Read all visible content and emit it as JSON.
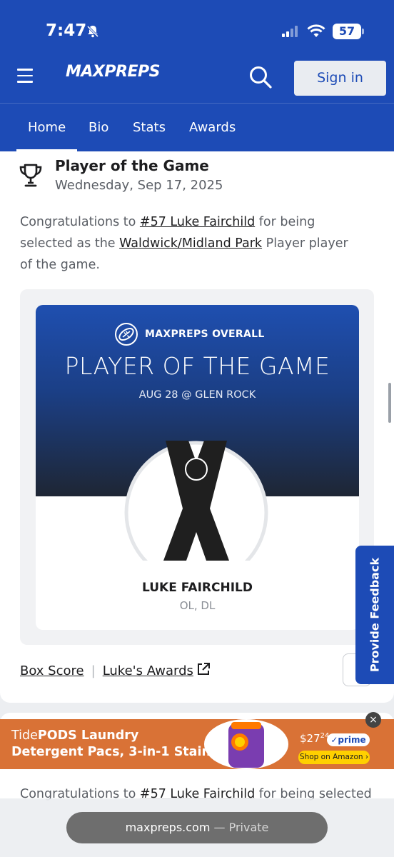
{
  "status_bar": {
    "time": "7:47",
    "battery": "57"
  },
  "header": {
    "logo": "MAXPREPS",
    "sign_in": "Sign in"
  },
  "nav": {
    "tabs": [
      {
        "label": "Home"
      },
      {
        "label": "Bio"
      },
      {
        "label": "Stats"
      },
      {
        "label": "Awards"
      }
    ]
  },
  "post": {
    "title": "Player of the Game",
    "date": "Wednesday, Sep 17, 2025",
    "text_before_player": "Congratulations to ",
    "player_link": "#57 Luke Fairchild",
    "text_middle": " for being selected as the ",
    "team_link": "Waldwick/Midland Park",
    "text_after": " Player player of the game."
  },
  "graphic": {
    "brand_line": "MAXPREPS OVERALL",
    "headline": "PLAYER OF THE GAME",
    "game_line": "AUG 28 @ GLEN ROCK",
    "player_name": "LUKE FAIRCHILD",
    "positions": "OL, DL"
  },
  "links": {
    "box_score": "Box Score",
    "awards": "Luke's Awards"
  },
  "feedback": "Provide Feedback",
  "ad": {
    "line1_brand": "Tide",
    "line1_rest": "PODS Laundry",
    "line2": "Detergent Pacs, 3-in-1 Stain…",
    "price": "$27",
    "price_cents": "24",
    "prime": "✓prime",
    "shop": "Shop on Amazon ›",
    "close": "×"
  },
  "post2": {
    "text_before_player": "Congratulations to ",
    "player_link": "#57 Luke Fairchild",
    "text_after": " for being selected"
  },
  "browser": {
    "domain": "maxpreps.com",
    "mode": " — Private"
  }
}
